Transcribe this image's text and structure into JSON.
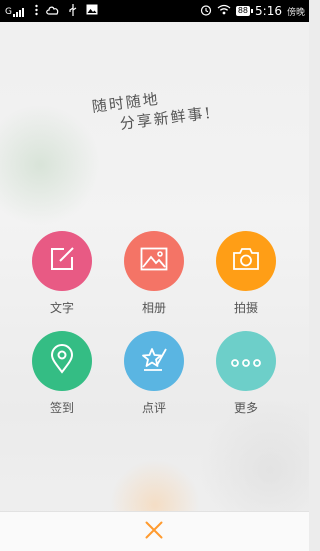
{
  "status_bar": {
    "carrier": "G",
    "time": "5:16",
    "battery": "88",
    "note": "傍晚",
    "icons": [
      "signal-icon",
      "menu-dots-icon",
      "cloud-icon",
      "usb-icon",
      "image-icon",
      "alarm-icon",
      "wifi-icon",
      "battery-icon"
    ]
  },
  "slogan": {
    "line1": "随时随地",
    "line2": "分享新鲜事!"
  },
  "actions": [
    {
      "label": "文字",
      "icon": "edit-icon",
      "color": "#e85a84"
    },
    {
      "label": "相册",
      "icon": "picture-icon",
      "color": "#f47466"
    },
    {
      "label": "拍摄",
      "icon": "camera-icon",
      "color": "#ff9e16"
    },
    {
      "label": "签到",
      "icon": "location-pin-icon",
      "color": "#34bd84"
    },
    {
      "label": "点评",
      "icon": "star-pen-icon",
      "color": "#5ab5e2"
    },
    {
      "label": "更多",
      "icon": "more-icon",
      "color": "#6dcfc9"
    }
  ],
  "close": {
    "icon": "close-icon",
    "color": "#ff9a2e"
  }
}
